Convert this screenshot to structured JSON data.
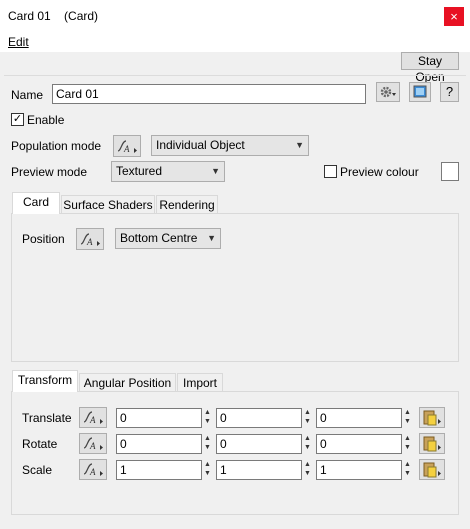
{
  "window": {
    "title": "Card 01    (Card)",
    "close_glyph": "×"
  },
  "menu": {
    "edit": "Edit"
  },
  "toolbar": {
    "stay_open": "Stay Open"
  },
  "name_row": {
    "label": "Name",
    "value": "Card 01",
    "help": "?"
  },
  "enable": {
    "label": "Enable",
    "checked": true,
    "glyph": "✓"
  },
  "population": {
    "label": "Population mode",
    "selected": "Individual Object"
  },
  "preview": {
    "label": "Preview mode",
    "selected": "Textured",
    "colour_label": "Preview colour",
    "colour_checked": false,
    "swatch_color": "#ffffff"
  },
  "tabs_top": {
    "items": [
      {
        "label": "Card"
      },
      {
        "label": "Surface Shaders"
      },
      {
        "label": "Rendering"
      }
    ],
    "active": 0,
    "position": {
      "label": "Position",
      "selected": "Bottom Centre"
    }
  },
  "tabs_bottom": {
    "items": [
      {
        "label": "Transform"
      },
      {
        "label": "Angular Position"
      },
      {
        "label": "Import"
      }
    ],
    "active": 0,
    "rows": [
      {
        "label": "Translate",
        "values": [
          "0",
          "0",
          "0"
        ]
      },
      {
        "label": "Rotate",
        "values": [
          "0",
          "0",
          "0"
        ]
      },
      {
        "label": "Scale",
        "values": [
          "1",
          "1",
          "1"
        ]
      }
    ]
  },
  "icons": {
    "settings": "gear-dropdown-icon",
    "preview": "preview-window-icon",
    "function": "function-curve-icon",
    "paste": "clipboard-paste-icon"
  },
  "colors": {
    "close": "#e81123",
    "accent": "#0078d7"
  }
}
